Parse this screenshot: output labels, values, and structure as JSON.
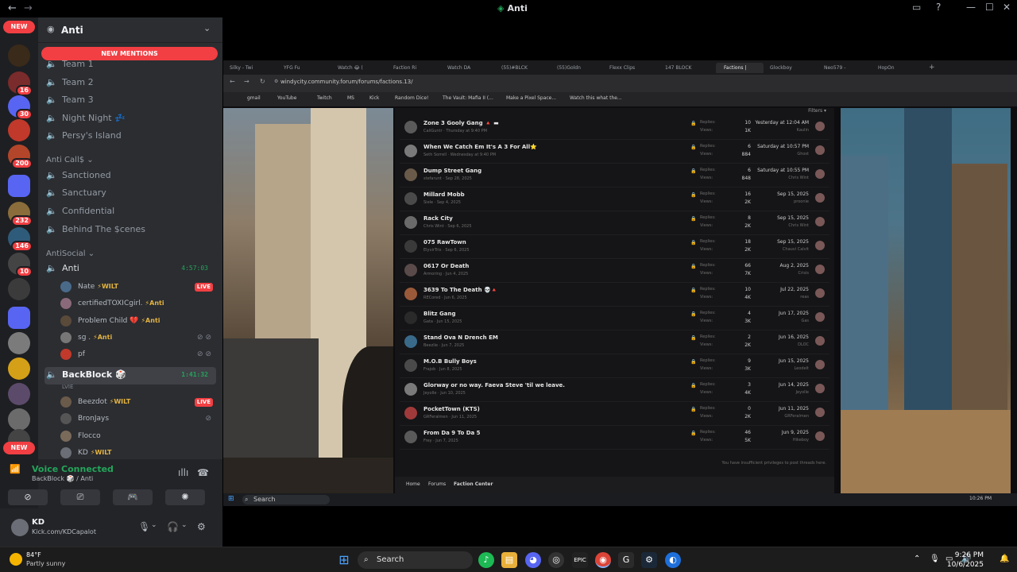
{
  "window": {
    "title": "Anti"
  },
  "server": {
    "name": "Anti"
  },
  "rail": {
    "new_top": "NEW",
    "new_bottom": "NEW",
    "badges": [
      "16",
      "30",
      "200",
      "232",
      "146",
      "10"
    ]
  },
  "sidebar": {
    "new_mentions": "NEW MENTIONS",
    "channels_top": [
      "Team 1",
      "Team 2",
      "Team 3",
      "Night Night 💤",
      "Persy's Island"
    ],
    "cat_calls": "Anti Call$",
    "channels_calls": [
      "Sanctioned",
      "Sanctuary",
      "Confidential",
      "Behind The $cenes"
    ],
    "cat_social": "AntiSocial",
    "voice_anti": {
      "name": "Anti",
      "timer": "4:57:03"
    },
    "anti_users": [
      {
        "name": "Nate",
        "tag": "⚡WILT",
        "live": "LIVE"
      },
      {
        "name": "certifiedTOXICgirl.",
        "tag": "⚡Anti"
      },
      {
        "name": "Problem Child 💔",
        "tag": "⚡Anti"
      },
      {
        "name": "sg .",
        "tag": "⚡Anti"
      },
      {
        "name": "pf",
        "tag": ""
      }
    ],
    "voice_backblock": {
      "name": "BackBlock 🎲",
      "sub": "LVIE",
      "timer": "1:41:32"
    },
    "backblock_users": [
      {
        "name": "Beezdot",
        "tag": "⚡WILT",
        "live": "LIVE"
      },
      {
        "name": "BronJays",
        "tag": ""
      },
      {
        "name": "Flocco",
        "tag": ""
      },
      {
        "name": "KD",
        "tag": "⚡WILT"
      }
    ]
  },
  "voice": {
    "status": "Voice Connected",
    "channel": "BackBlock 🎲 / Anti"
  },
  "user": {
    "name": "KD",
    "status": "Kick.com/KDCapalot"
  },
  "browser": {
    "tabs": [
      "Silky - Twi",
      "YFG Fu",
      "Watch 😂 (",
      "Faction Ri",
      "Watch DA",
      "(55)#BLCK",
      "(55)Goldn",
      "Flexx Clips",
      "147 BLOCK",
      "Factions |",
      "Glockboy",
      "Neo579 -",
      "HopOn"
    ],
    "url": "windycity.community.forum/forums/factions.13/",
    "bookmarks": [
      "gmail",
      "YouTube",
      "Twitch",
      "MS",
      "Kick",
      "Random Dice!",
      "The Vault: Mafia II (...",
      "Make a Pixel Spacе...",
      "Watch this what the..."
    ]
  },
  "forum": {
    "filters": "Filters ▾",
    "replies_label": "Replies:",
    "views_label": "Views:",
    "threads": [
      {
        "title": "Zone 3 Gooly Gang 🔺 ▬",
        "meta": "CaliGuntr · Thursday at 9:40 PM",
        "replies": "10",
        "views": "1K",
        "date": "Yesterday at 12:04 AM",
        "last": "Kaulin"
      },
      {
        "title": "When We Catch Em It's A 3 For All⭐",
        "meta": "Seth Sorrell · Wednesday at 9:40 PM",
        "replies": "6",
        "views": "884",
        "date": "Saturday at 10:57 PM",
        "last": "Ghost"
      },
      {
        "title": "Dump Street Gang",
        "meta": "stefarunt · Sep 28, 2025",
        "replies": "6",
        "views": "848",
        "date": "Saturday at 10:55 PM",
        "last": "Chris Wint"
      },
      {
        "title": "Millard Mobb",
        "meta": "Siele · Sep 4, 2025",
        "replies": "16",
        "views": "2K",
        "date": "Sep 15, 2025",
        "last": "proonie"
      },
      {
        "title": "Rack City",
        "meta": "Chris Wint · Sep 6, 2025",
        "replies": "8",
        "views": "2K",
        "date": "Sep 15, 2025",
        "last": "Chris Wint"
      },
      {
        "title": "075 RawTown",
        "meta": "ElyvirTrix · Sep 6, 2025",
        "replies": "18",
        "views": "2K",
        "date": "Sep 15, 2025",
        "last": "Chauvi Calvit"
      },
      {
        "title": "0617 Or Death",
        "meta": "Armoring · Jun 4, 2025",
        "replies": "66",
        "views": "7K",
        "date": "Aug 2, 2025",
        "last": "Crisis"
      },
      {
        "title": "3639 To The Death 💀🔺",
        "meta": "RECored · Jun 6, 2025",
        "replies": "10",
        "views": "4K",
        "date": "Jul 22, 2025",
        "last": "reas"
      },
      {
        "title": "Blitz Gang",
        "meta": "Gata · Jun 15, 2025",
        "replies": "4",
        "views": "3K",
        "date": "Jun 17, 2025",
        "last": "Gas"
      },
      {
        "title": "Stand Ova N Drench EM",
        "meta": "Beezlie · Jun 7, 2025",
        "replies": "2",
        "views": "2K",
        "date": "Jun 16, 2025",
        "last": "DLOC"
      },
      {
        "title": "M.O.B Bully Boys",
        "meta": "Frajob · Jun 8, 2025",
        "replies": "9",
        "views": "3K",
        "date": "Jun 15, 2025",
        "last": "Leodelt"
      },
      {
        "title": "Glorway or no way. Faeva Steve 'til we leave.",
        "meta": "Jeyolle · Jun 10, 2025",
        "replies": "3",
        "views": "4K",
        "date": "Jun 14, 2025",
        "last": "Jeyolle"
      },
      {
        "title": "PocketTown (KTS)",
        "meta": "GRFeralmen · Jun 11, 2025",
        "replies": "0",
        "views": "2K",
        "date": "Jun 11, 2025",
        "last": "GRFeralmen"
      },
      {
        "title": "From Da 9 To Da 5",
        "meta": "Frey · Jun 7, 2025",
        "replies": "46",
        "views": "5K",
        "date": "Jun 9, 2025",
        "last": "Hikeboy"
      }
    ],
    "no_post": "You have insufficient privileges to post threads here.",
    "nav": [
      "Home",
      "Forums",
      "Faction Center"
    ]
  },
  "inner_taskbar": {
    "search": "Search",
    "time": "10:26 PM"
  },
  "taskbar": {
    "temp": "84°F",
    "weather": "Partly sunny",
    "search": "Search",
    "time": "9:26 PM",
    "date": "10/6/2025"
  }
}
